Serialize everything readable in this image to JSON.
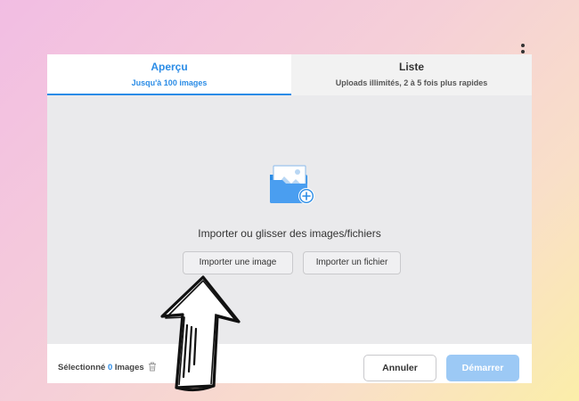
{
  "tabs": [
    {
      "title": "Aperçu",
      "subtitle": "Jusqu'à 100 images",
      "active": true
    },
    {
      "title": "Liste",
      "subtitle": "Uploads illimités, 2 à 5 fois plus rapides",
      "active": false
    }
  ],
  "dropzone": {
    "text": "Importer ou glisser des images/fichiers",
    "import_image_label": "Importer une image",
    "import_file_label": "Importer un fichier"
  },
  "footer": {
    "selected_prefix": "Sélectionné",
    "selected_count": "0",
    "selected_suffix": "Images",
    "cancel_label": "Annuler",
    "start_label": "Démarrer"
  },
  "icons": {
    "menu": "kebab-menu-icon",
    "dropzone": "folder-image-plus-icon",
    "trash": "trash-icon",
    "annotation": "hand-drawn-arrow"
  },
  "colors": {
    "accent": "#2b8ce6",
    "start_button": "#9cc9f5",
    "dropzone_bg": "#eaeaec"
  }
}
